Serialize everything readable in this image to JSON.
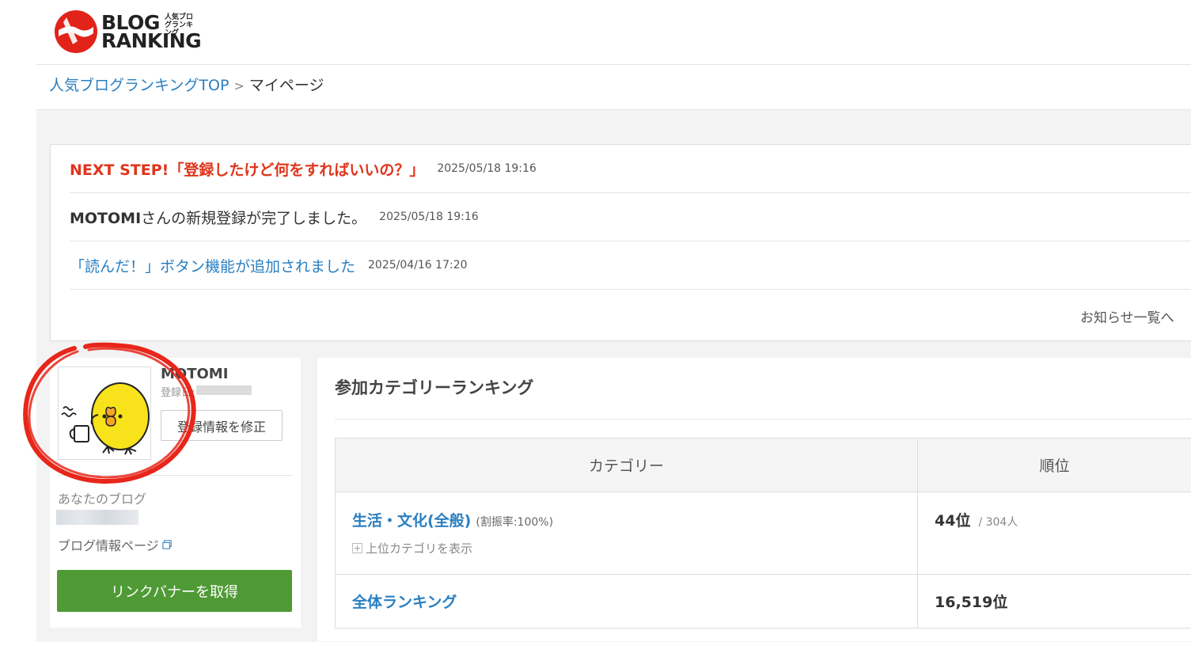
{
  "header": {
    "logo_line1": "BLOG",
    "logo_line2": "RANKING",
    "logo_small": "人気ブログランキング"
  },
  "breadcrumb": {
    "home_label": "人気ブログランキングTOP",
    "separator": ">",
    "current": "マイページ"
  },
  "news": {
    "items": [
      {
        "title": "NEXT STEP!「登録したけど何をすればいいの？」",
        "date": "2025/05/18 19:16",
        "style": "red"
      },
      {
        "title_bold": "MOTOMI",
        "title_rest": "さんの新規登録が完了しました。",
        "date": "2025/05/18 19:16",
        "style": "dark"
      },
      {
        "title": "「読んだ！」ボタン機能が追加されました",
        "date": "2025/04/16 17:20",
        "style": "blue"
      }
    ],
    "more_label": "お知らせ一覧へ"
  },
  "profile": {
    "name": "MOTOMI",
    "registered_label": "登録日:",
    "edit_button": "登録情報を修正",
    "your_blog_label": "あなたのブログ",
    "blog_info_link": "ブログ情報ページ",
    "link_banner_button": "リンクバナーを取得"
  },
  "ranking": {
    "title": "参加カテゴリーランキング",
    "headers": [
      "カテゴリー",
      "順位"
    ],
    "rows": [
      {
        "category": "生活・文化(全般)",
        "ratio": "(割振率:100%)",
        "show_parent": "上位カテゴリを表示",
        "rank": "44位",
        "total": "/ 304人"
      },
      {
        "category": "全体ランキング",
        "rank": "16,519位"
      }
    ]
  },
  "colors": {
    "link_blue": "#2a7fc1",
    "alert_red": "#e0341b",
    "button_green": "#4f9a35",
    "annotation_red": "#e8261a"
  }
}
